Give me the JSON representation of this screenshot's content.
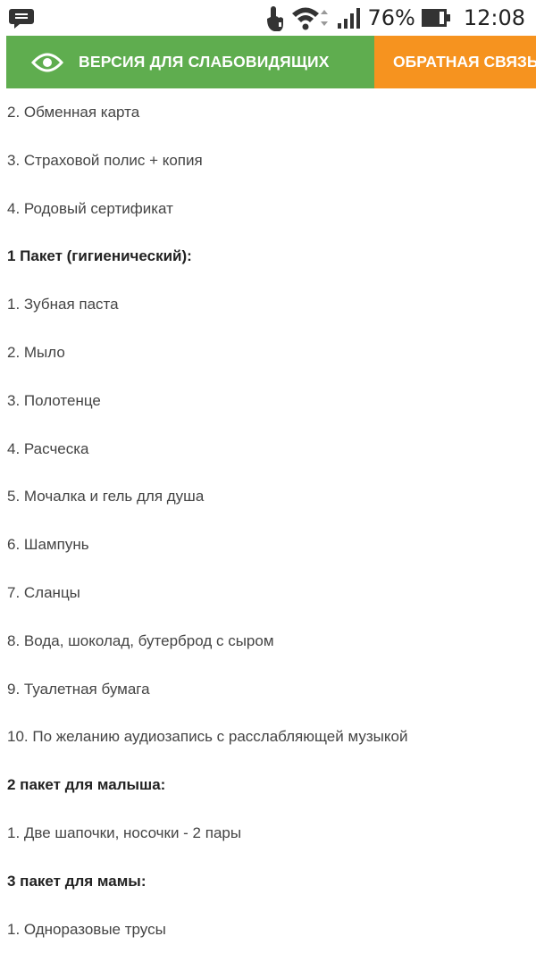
{
  "status_bar": {
    "battery": "76%",
    "time": "12:08",
    "icons": [
      "chat-bubble-icon",
      "touch-icon",
      "wifi-icon",
      "signal-icon",
      "battery-icon"
    ]
  },
  "top_bar": {
    "vision_label": "ВЕРСИЯ ДЛЯ СЛАБОВИДЯЩИХ",
    "feedback_label": "ОБРАТНАЯ СВЯЗЬ",
    "colors": {
      "vision_bg": "#5fad4f",
      "feedback_bg": "#f6931f"
    }
  },
  "content": {
    "lines": [
      {
        "text": "2. Обменная карта",
        "bold": false
      },
      {
        "text": "3. Страховой полис + копия",
        "bold": false
      },
      {
        "text": "4. Родовый сертификат",
        "bold": false
      },
      {
        "text": "1 Пакет (гигиенический):",
        "bold": true
      },
      {
        "text": "1. Зубная паста",
        "bold": false
      },
      {
        "text": "2. Мыло",
        "bold": false
      },
      {
        "text": "3. Полотенце",
        "bold": false
      },
      {
        "text": "4. Расческа",
        "bold": false
      },
      {
        "text": "5. Мочалка и гель для душа",
        "bold": false
      },
      {
        "text": "6. Шампунь",
        "bold": false
      },
      {
        "text": "7. Сланцы",
        "bold": false
      },
      {
        "text": "8. Вода, шоколад, бутерброд с сыром",
        "bold": false
      },
      {
        "text": "9. Туалетная бумага",
        "bold": false
      },
      {
        "text": "10. По желанию аудиозапись с расслабляющей музыкой",
        "bold": false
      },
      {
        "text": "2 пакет для малыша:",
        "bold": true
      },
      {
        "text": "1. Две шапочки, носочки - 2 пары",
        "bold": false
      },
      {
        "text": "3 пакет для мамы:",
        "bold": true
      },
      {
        "text": "1. Одноразовые трусы",
        "bold": false
      }
    ]
  }
}
